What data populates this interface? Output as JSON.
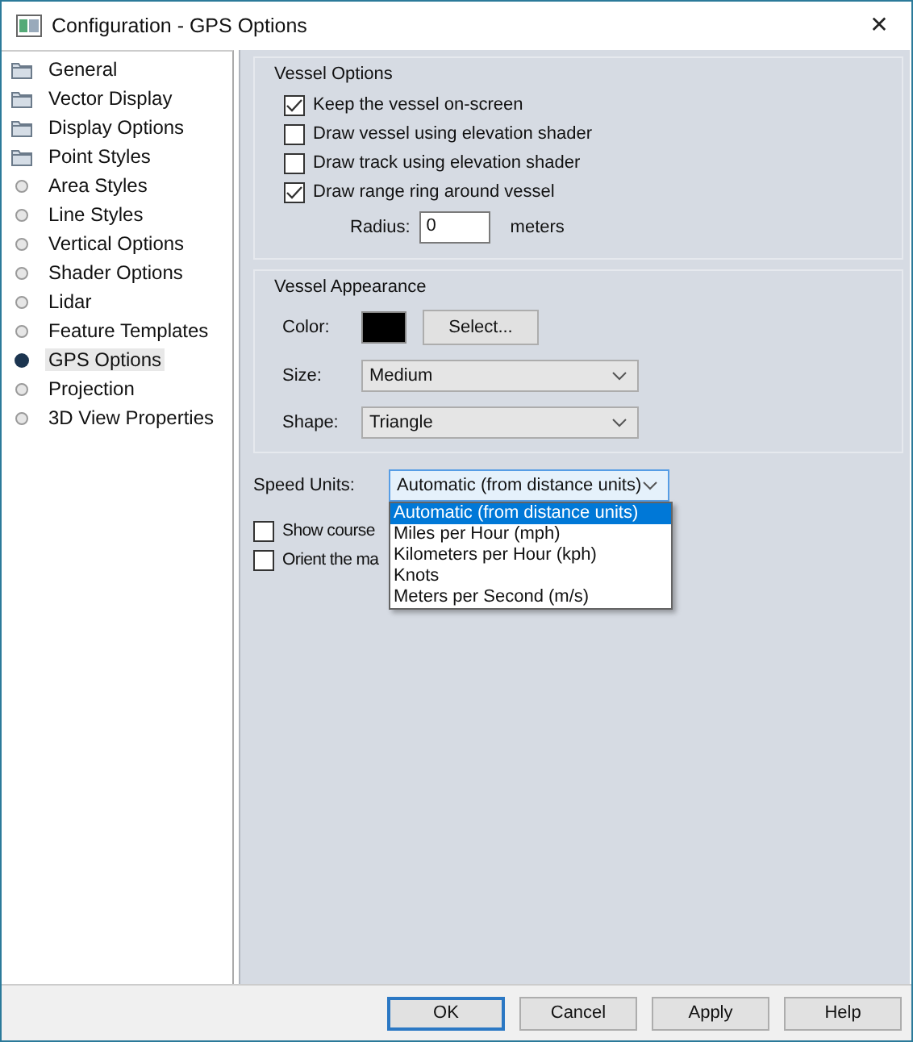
{
  "window": {
    "title": "Configuration - GPS Options",
    "close": "✕"
  },
  "sidebar": {
    "items": [
      {
        "label": "General",
        "kind": "folder",
        "selected": false
      },
      {
        "label": "Vector Display",
        "kind": "folder",
        "selected": false
      },
      {
        "label": "Display Options",
        "kind": "folder",
        "selected": false
      },
      {
        "label": "Point Styles",
        "kind": "folder",
        "selected": false
      },
      {
        "label": "Area Styles",
        "kind": "page",
        "selected": false
      },
      {
        "label": "Line Styles",
        "kind": "page",
        "selected": false
      },
      {
        "label": "Vertical Options",
        "kind": "page",
        "selected": false
      },
      {
        "label": "Shader Options",
        "kind": "page",
        "selected": false
      },
      {
        "label": "Lidar",
        "kind": "page",
        "selected": false
      },
      {
        "label": "Feature Templates",
        "kind": "page",
        "selected": false
      },
      {
        "label": "GPS Options",
        "kind": "page",
        "selected": true
      },
      {
        "label": "Projection",
        "kind": "page",
        "selected": false
      },
      {
        "label": "3D View Properties",
        "kind": "page",
        "selected": false
      }
    ]
  },
  "vessel_options": {
    "title": "Vessel Options",
    "checkboxes": [
      {
        "label": "Keep the vessel on-screen",
        "checked": true
      },
      {
        "label": "Draw vessel using elevation shader",
        "checked": false
      },
      {
        "label": "Draw track using elevation shader",
        "checked": false
      },
      {
        "label": "Draw range ring around vessel",
        "checked": true
      }
    ],
    "radius": {
      "label": "Radius:",
      "value": "0",
      "unit": "meters"
    }
  },
  "vessel_appearance": {
    "title": "Vessel Appearance",
    "color": {
      "label": "Color:",
      "color": "#000000",
      "button": "Select..."
    },
    "size": {
      "label": "Size:",
      "value": "Medium"
    },
    "shape": {
      "label": "Shape:",
      "value": "Triangle"
    }
  },
  "speed_units": {
    "label": "Speed  Units:",
    "value": "Automatic (from distance units)",
    "options": [
      {
        "label": "Automatic (from distance units)",
        "selected": true
      },
      {
        "label": "Miles per Hour (mph)",
        "selected": false
      },
      {
        "label": "Kilometers per Hour (kph)",
        "selected": false
      },
      {
        "label": "Knots",
        "selected": false
      },
      {
        "label": "Meters per Second (m/s)",
        "selected": false
      }
    ]
  },
  "extra_checkboxes": [
    {
      "label": "Show course",
      "checked": false
    },
    {
      "label": "Orient the ma",
      "checked": false
    }
  ],
  "buttons": [
    {
      "label": "OK",
      "default": true
    },
    {
      "label": "Cancel",
      "default": false
    },
    {
      "label": "Apply",
      "default": false
    },
    {
      "label": "Help",
      "default": false
    }
  ]
}
